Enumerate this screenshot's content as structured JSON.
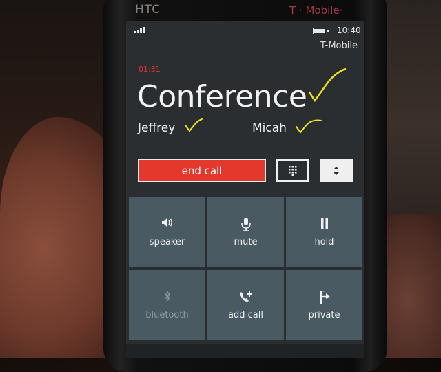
{
  "device": {
    "brand": "HTC",
    "operator_logo": "T · Mobile·"
  },
  "status_bar": {
    "time": "10:40",
    "carrier": "T-Mobile"
  },
  "call": {
    "timer": "01:31",
    "title": "Conference",
    "participants": [
      "Jeffrey",
      "Micah"
    ]
  },
  "controls": {
    "end_call_label": "end call"
  },
  "tiles": [
    {
      "label": "speaker",
      "icon": "speaker-icon",
      "enabled": true
    },
    {
      "label": "mute",
      "icon": "microphone-icon",
      "enabled": true
    },
    {
      "label": "hold",
      "icon": "pause-icon",
      "enabled": true
    },
    {
      "label": "bluetooth",
      "icon": "bluetooth-icon",
      "enabled": false
    },
    {
      "label": "add call",
      "icon": "add-call-icon",
      "enabled": true
    },
    {
      "label": "private",
      "icon": "private-icon",
      "enabled": true
    }
  ],
  "colors": {
    "accent_red": "#e3382b",
    "tile": "#4a5a63",
    "screen": "#2b2e31",
    "checkmark": "#f2e41c"
  }
}
